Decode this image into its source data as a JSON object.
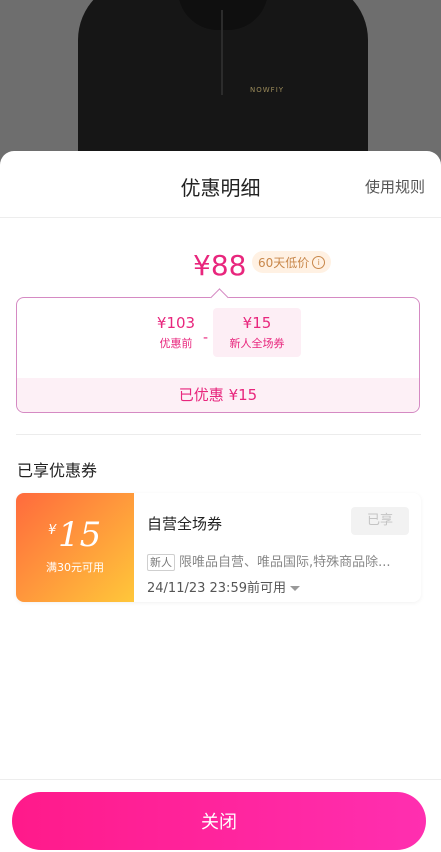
{
  "sheet": {
    "title": "优惠明细",
    "rules_link": "使用规则"
  },
  "product": {
    "brand_logo": "NOWFIY"
  },
  "price": {
    "final": "¥88",
    "low_price_badge": "60天低价",
    "info_icon": "ⓘ"
  },
  "calculation": {
    "before_amount": "¥103",
    "before_label": "优惠前",
    "operator": "-",
    "coupon_amount": "¥15",
    "coupon_label": "新人全场券",
    "saved_text": "已优惠 ¥15"
  },
  "coupons_section": {
    "title": "已享优惠券",
    "coupons": [
      {
        "currency": "¥",
        "value": "15",
        "condition": "满30元可用",
        "name": "自营全场券",
        "status": "已享",
        "tag": "新人",
        "description": "限唯品自营、唯品国际,特殊商品除...",
        "expiry": "24/11/23 23:59前可用"
      }
    ]
  },
  "footer": {
    "close_label": "关闭"
  },
  "colors": {
    "accent": "#e8267d",
    "coupon_gradient_start": "#ff6a3d",
    "coupon_gradient_end": "#ffc73a",
    "button_gradient_start": "#ff1a8a",
    "button_gradient_end": "#ff2fb0"
  }
}
